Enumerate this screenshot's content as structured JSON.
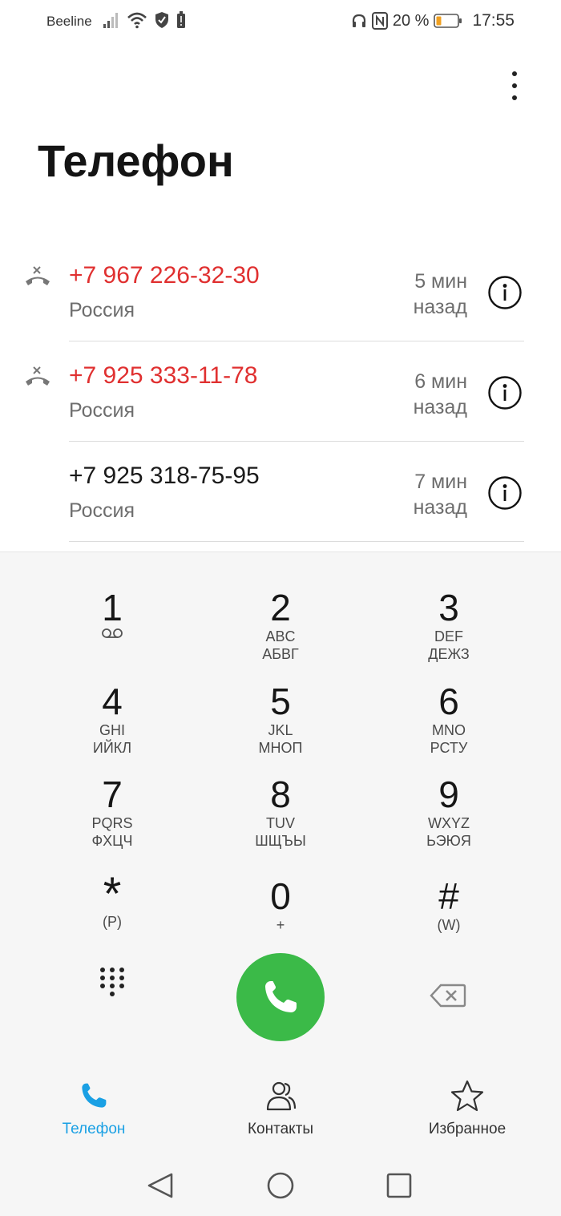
{
  "status_bar": {
    "carrier": "Beeline",
    "battery_percent": "20 %",
    "time": "17:55",
    "icons": [
      "signal-icon",
      "wifi-icon",
      "vpn-shield-icon",
      "battery-alert-icon",
      "headphones-icon",
      "nfc-icon",
      "battery-icon"
    ]
  },
  "header": {
    "title": "Телефон",
    "menu_icon": "more-vert-icon"
  },
  "calls": [
    {
      "number": "+7 967 226-32-30",
      "location": "Россия",
      "time": "5 мин назад",
      "missed": true
    },
    {
      "number": "+7 925 333-11-78",
      "location": "Россия",
      "time": "6 мин назад",
      "missed": true
    },
    {
      "number": "+7 925 318-75-95",
      "location": "Россия",
      "time": "7 мин назад",
      "missed": false
    }
  ],
  "dialpad": {
    "keys": [
      {
        "digit": "1",
        "sub1": "",
        "sub2": ""
      },
      {
        "digit": "2",
        "sub1": "ABC",
        "sub2": "АБВГ"
      },
      {
        "digit": "3",
        "sub1": "DEF",
        "sub2": "ДЕЖЗ"
      },
      {
        "digit": "4",
        "sub1": "GHI",
        "sub2": "ИЙКЛ"
      },
      {
        "digit": "5",
        "sub1": "JKL",
        "sub2": "МНОП"
      },
      {
        "digit": "6",
        "sub1": "MNO",
        "sub2": "РСТУ"
      },
      {
        "digit": "7",
        "sub1": "PQRS",
        "sub2": "ФХЦЧ"
      },
      {
        "digit": "8",
        "sub1": "TUV",
        "sub2": "ШЩЪЫ"
      },
      {
        "digit": "9",
        "sub1": "WXYZ",
        "sub2": "ЬЭЮЯ"
      },
      {
        "digit": "*",
        "sub1": "(P)",
        "sub2": ""
      },
      {
        "digit": "0",
        "sub1": "+",
        "sub2": ""
      },
      {
        "digit": "#",
        "sub1": "(W)",
        "sub2": ""
      }
    ],
    "call_color": "#3bba48"
  },
  "bottom_nav": {
    "items": [
      {
        "label": "Телефон",
        "icon": "phone-icon",
        "active": true
      },
      {
        "label": "Контакты",
        "icon": "contacts-icon",
        "active": false
      },
      {
        "label": "Избранное",
        "icon": "star-icon",
        "active": false
      }
    ],
    "active_color": "#1aa0e4"
  },
  "system_nav": [
    "back-icon",
    "home-icon",
    "recents-icon"
  ],
  "colors": {
    "missed": "#e03030",
    "text_secondary": "#6e6e6e"
  }
}
